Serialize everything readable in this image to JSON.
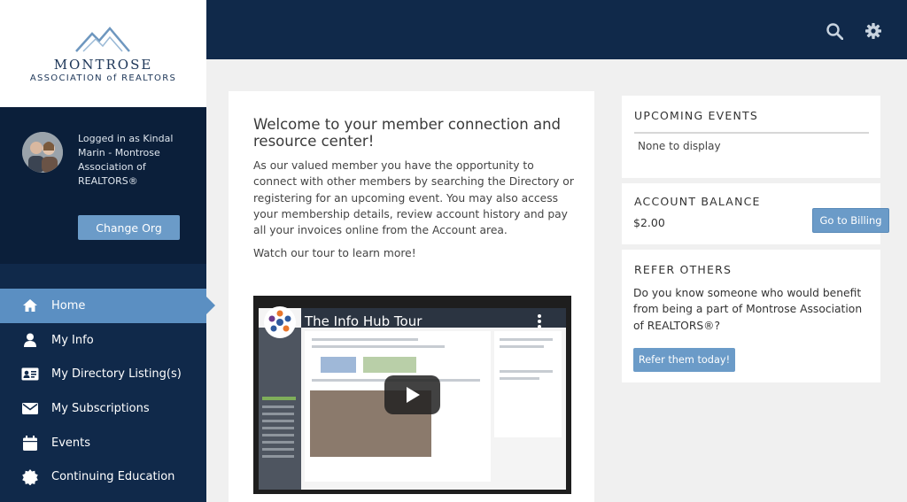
{
  "brand": {
    "name": "MONTROSE",
    "subtitle": "ASSOCIATION of REALTORS"
  },
  "user": {
    "logged_in_text": "Logged in as Kindal Marin - Montrose Association of REALTORS®",
    "change_org_label": "Change Org"
  },
  "nav": {
    "items": [
      {
        "label": "Home",
        "icon": "home-icon",
        "active": true
      },
      {
        "label": "My Info",
        "icon": "user-icon",
        "active": false
      },
      {
        "label": "My Directory Listing(s)",
        "icon": "id-card-icon",
        "active": false
      },
      {
        "label": "My Subscriptions",
        "icon": "envelope-icon",
        "active": false
      },
      {
        "label": "Events",
        "icon": "calendar-icon",
        "active": false
      },
      {
        "label": "Continuing Education",
        "icon": "badge-icon",
        "active": false
      }
    ]
  },
  "topbar": {
    "icons": [
      "search-icon",
      "gear-icon"
    ]
  },
  "welcome": {
    "title": "Welcome to your member connection and resource center!",
    "paragraph": "As our valued member you have the opportunity to connect with other members by searching the Directory or registering for an upcoming event. You may also access your membership details, review account history and pay all your invoices online from the Account area.",
    "tour_text": "Watch our tour to learn more!",
    "video_title": "The Info Hub Tour"
  },
  "events": {
    "heading": "UPCOMING EVENTS",
    "empty_text": "None to display"
  },
  "balance": {
    "heading": "ACCOUNT BALANCE",
    "amount": "$2.00",
    "button_label": "Go to Billing"
  },
  "refer": {
    "heading": "REFER OTHERS",
    "question": "Do you know someone who would benefit from being a part of Montrose Association of REALTORS®?",
    "button_label": "Refer them today!"
  },
  "colors": {
    "navy": "#10294a",
    "accent": "#5b8fc2",
    "button": "#6b9bc8"
  }
}
